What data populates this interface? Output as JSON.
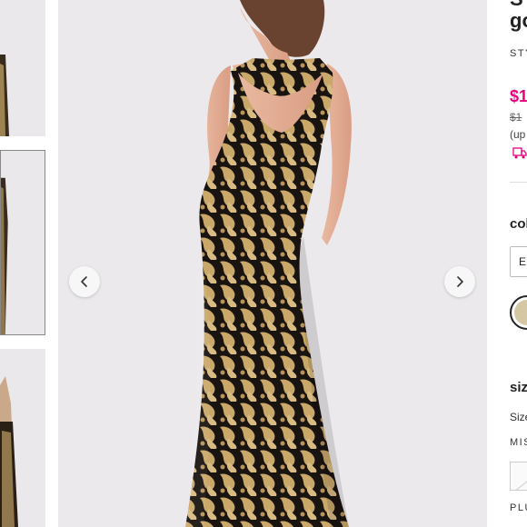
{
  "product": {
    "title_line1": "S",
    "title_line2": "go",
    "style_label": "STY",
    "price": "$1",
    "original_price": "$1",
    "price_note": "(up",
    "color_heading": "col",
    "color_select_value": "E",
    "size_heading": "siz",
    "size_guide_label": "Size",
    "misses_label": "MIS",
    "plus_label": "PLU"
  },
  "gallery": {
    "thumbnail_count": 3,
    "selected_thumbnail": 2
  },
  "colors": {
    "accent_pink": "#e6007e",
    "swatch_gold": "#d6c7a4",
    "lace_gold": "#c9a86a",
    "lace_black": "#1a1410"
  },
  "icons": {
    "prev": "chevron-left-icon",
    "next": "chevron-right-icon",
    "shipping": "truck-icon"
  }
}
